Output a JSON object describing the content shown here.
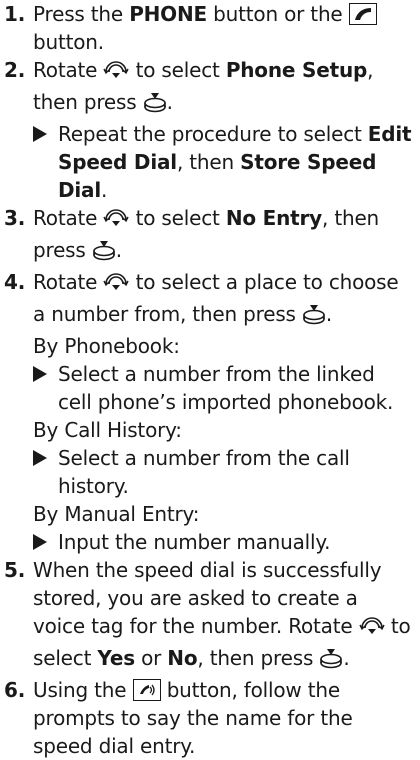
{
  "steps": [
    {
      "num": "1.",
      "t1": "Press the ",
      "b1": "PHONE",
      "t2": " button or the ",
      "t3": " button."
    },
    {
      "num": "2.",
      "t1": "Rotate ",
      "t2": " to select ",
      "b1": "Phone Setup",
      "t3": ", then press ",
      "t4": ".",
      "sub": {
        "t1": "Repeat the procedure to select ",
        "b1": "Edit Speed Dial",
        "t2": ", then ",
        "b2": "Store Speed Dial",
        "t3": "."
      }
    },
    {
      "num": "3.",
      "t1": "Rotate ",
      "t2": " to select ",
      "b1": "No Entry",
      "t3": ", then press ",
      "t4": "."
    },
    {
      "num": "4.",
      "t1": "Rotate ",
      "t2": " to select a place to choose a number from, then press ",
      "t3": ".",
      "options": [
        {
          "label": "By Phonebook:",
          "note": "Select a number from the linked cell phone’s imported phonebook."
        },
        {
          "label": "By Call History:",
          "note": "Select a number from the call history."
        },
        {
          "label": "By Manual Entry:",
          "note": "Input the number manually."
        }
      ]
    },
    {
      "num": "5.",
      "t1": "When the speed dial is successfully stored, you are asked to create a voice tag for the number. Rotate ",
      "t2": " to select ",
      "b1": "Yes",
      "t3": " or ",
      "b2": "No",
      "t4": ", then press ",
      "t5": "."
    },
    {
      "num": "6.",
      "t1": "Using the ",
      "t2": " button, follow the prompts to say the name for the speed dial entry."
    }
  ],
  "icons": {
    "phone_button": "phone-icon",
    "selector_knob": "rotate-knob-icon",
    "press_knob": "press-knob-icon",
    "talk_button": "talk-button-icon",
    "bullet": "triangle-bullet-icon"
  }
}
